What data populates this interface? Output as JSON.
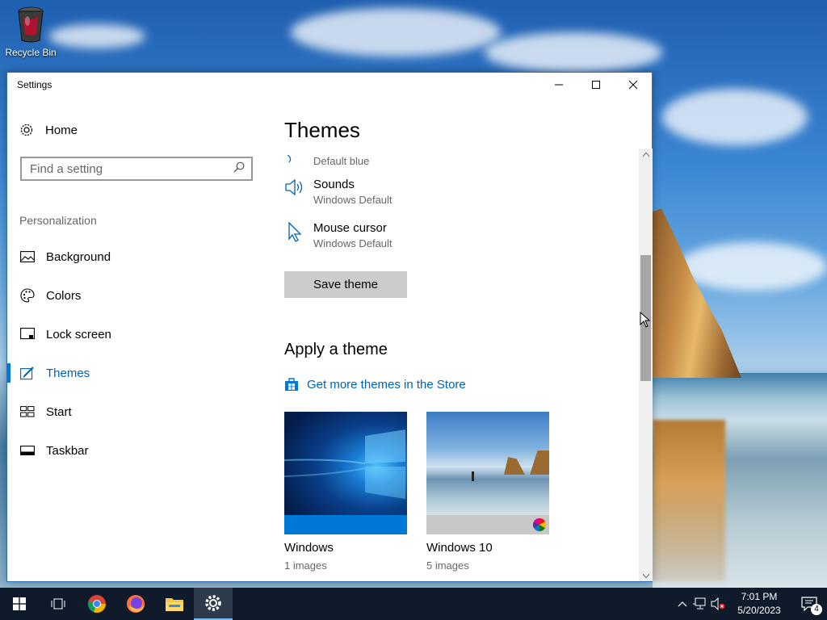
{
  "desktop": {
    "recycle_bin_label": "Recycle Bin"
  },
  "window": {
    "title": "Settings"
  },
  "sidebar": {
    "home_label": "Home",
    "search_placeholder": "Find a setting",
    "section_label": "Personalization",
    "items": [
      {
        "label": "Background",
        "icon": "picture-icon",
        "active": false
      },
      {
        "label": "Colors",
        "icon": "palette-icon",
        "active": false
      },
      {
        "label": "Lock screen",
        "icon": "lock-screen-icon",
        "active": false
      },
      {
        "label": "Themes",
        "icon": "brush-icon",
        "active": true
      },
      {
        "label": "Start",
        "icon": "start-grid-icon",
        "active": false
      },
      {
        "label": "Taskbar",
        "icon": "taskbar-icon",
        "active": false
      }
    ]
  },
  "content": {
    "title": "Themes",
    "color_value": "Default blue",
    "sounds_label": "Sounds",
    "sounds_value": "Windows Default",
    "cursor_label": "Mouse cursor",
    "cursor_value": "Windows Default",
    "save_button": "Save theme",
    "apply_title": "Apply a theme",
    "store_link": "Get more themes in the Store",
    "themes": [
      {
        "name": "Windows",
        "count": "1 images"
      },
      {
        "name": "Windows 10",
        "count": "5 images"
      }
    ]
  },
  "taskbar": {
    "time": "7:01 PM",
    "date": "5/20/2023",
    "notification_count": "4"
  },
  "colors": {
    "accent": "#0078d7",
    "link": "#0063b1",
    "taskbar_bg": "#0f1b2a"
  }
}
